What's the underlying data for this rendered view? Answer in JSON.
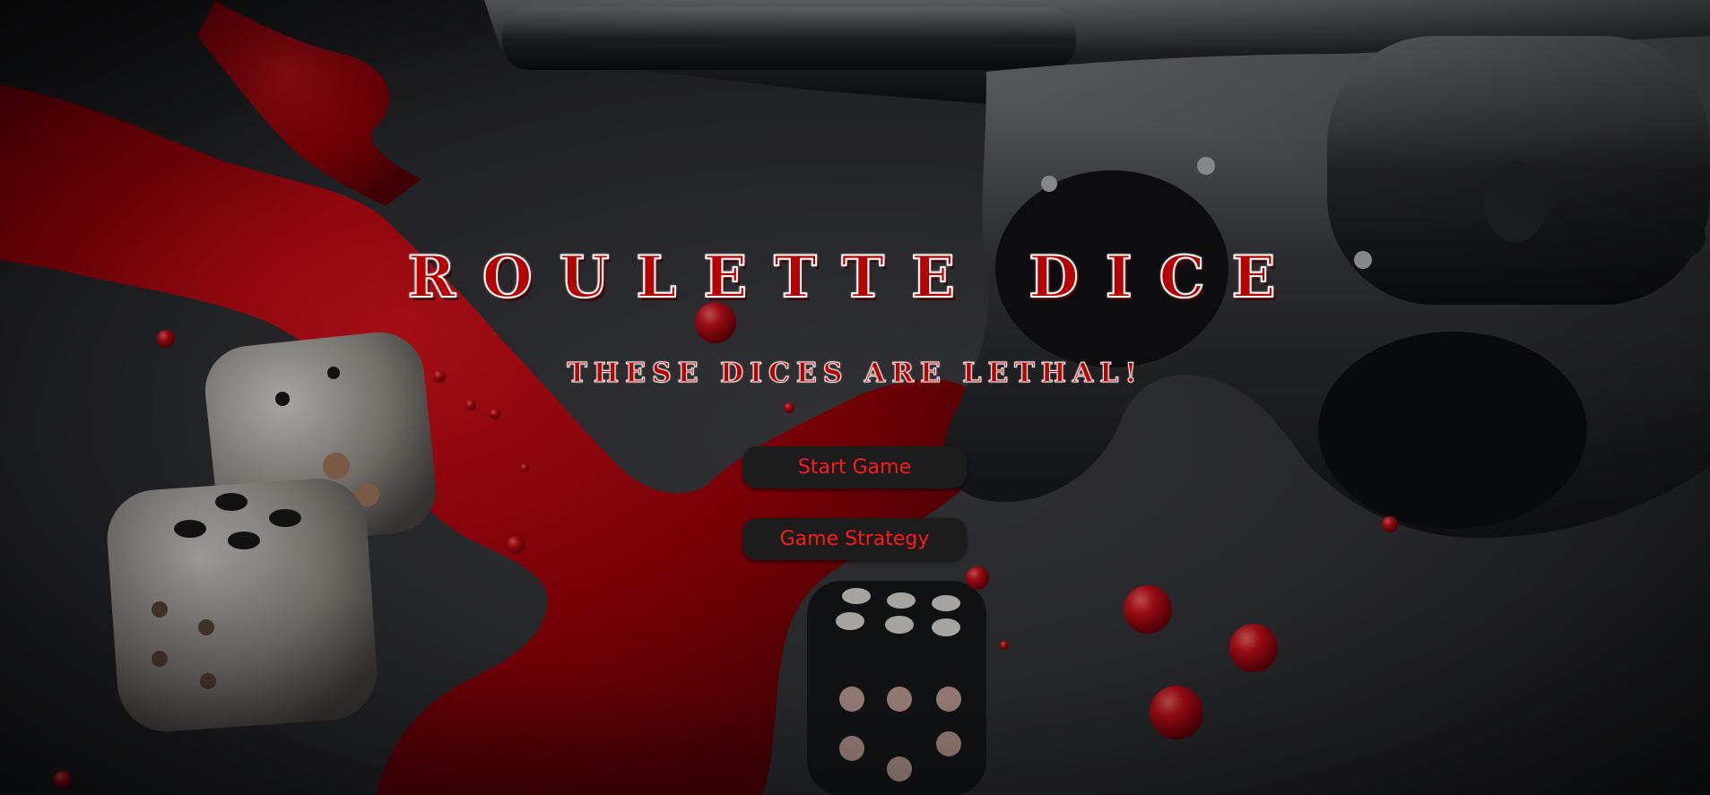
{
  "game": {
    "title": "ROULETTE DICE",
    "subtitle": "THESE DICES ARE LETHAL!"
  },
  "menu": {
    "start_label": "Start Game",
    "strategy_label": "Game Strategy"
  },
  "colors": {
    "accent_red": "#b80000",
    "button_text": "#ff1a1a",
    "button_bg": "#1c1c1c"
  },
  "background": {
    "scene": [
      "revolver",
      "dice",
      "blood-splatter"
    ]
  }
}
